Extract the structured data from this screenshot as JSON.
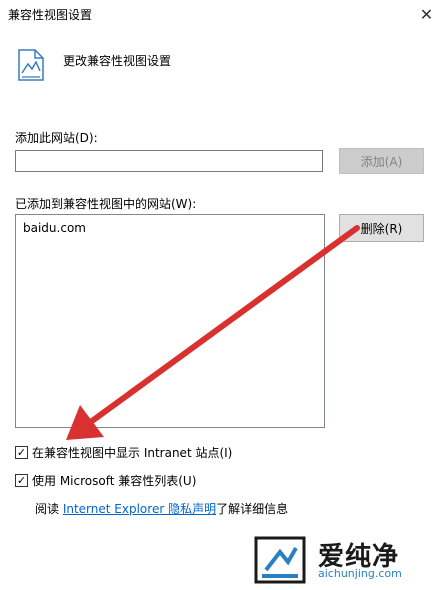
{
  "window": {
    "title": "兼容性视图设置",
    "close_glyph": "✕"
  },
  "header": {
    "icon": "compat-document-icon",
    "title": "更改兼容性视图设置"
  },
  "add_site": {
    "label": "添加此网站(D):",
    "value": "",
    "placeholder": "",
    "button_label": "添加(A)"
  },
  "added_sites": {
    "label": "已添加到兼容性视图中的网站(W):",
    "items": [
      "baidu.com"
    ],
    "remove_button_label": "删除(R)"
  },
  "options": {
    "intranet": {
      "label": "在兼容性视图中显示 Intranet 站点(I)",
      "checked": true
    },
    "ms_list": {
      "label": "使用 Microsoft 兼容性列表(U)",
      "checked": true
    }
  },
  "privacy": {
    "prefix": "阅读 ",
    "link": "Internet Explorer 隐私声明",
    "suffix": "了解详细信息"
  },
  "watermark": {
    "brand": "爱纯净",
    "url": "aichunjing.com"
  },
  "colors": {
    "arrow": "#d93030",
    "link": "#0066cc",
    "watermark_blue": "#2980c4"
  }
}
